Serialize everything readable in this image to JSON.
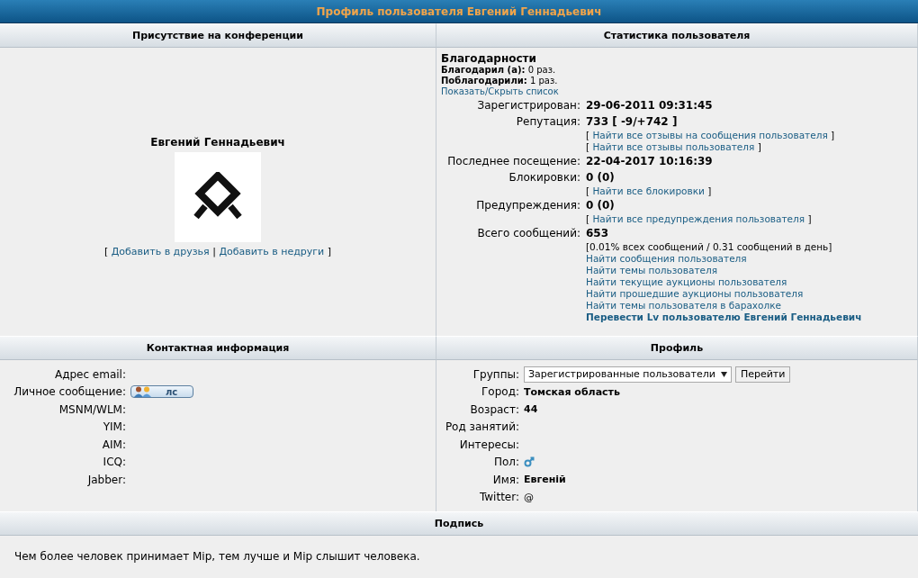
{
  "title": "Профиль пользователя Евгений Геннадьевич",
  "presence": {
    "header": "Присутствие на конференции",
    "username": "Евгений Геннадьевич",
    "links_open": "[",
    "links": [
      "Добавить в друзья",
      "Добавить в недруги"
    ],
    "links_separator": "|",
    "links_close": "]"
  },
  "stats": {
    "header": "Статистика пользователя",
    "thanks": {
      "title": "Благодарности",
      "lines": [
        {
          "label": "Благодарил (а):",
          "value": "0 раз."
        },
        {
          "label": "Поблагодарили:",
          "value": "1 раз."
        }
      ],
      "toggle": "Показать/Скрыть список"
    },
    "rows": [
      {
        "label": "Зарегистрирован:",
        "value": "29-06-2011 09:31:45",
        "extras": []
      },
      {
        "label": "Репутация:",
        "value": "733 [ -9/+742 ]",
        "extras": [
          {
            "kind": "bracket_link",
            "open": "[",
            "text": "Найти все отзывы на сообщения пользователя",
            "close": "]"
          },
          {
            "kind": "bracket_link",
            "open": "[",
            "text": "Найти все отзывы пользователя",
            "close": "]"
          }
        ]
      },
      {
        "label": "Последнее посещение:",
        "value": "22-04-2017 10:16:39",
        "extras": []
      },
      {
        "label": "Блокировки:",
        "value": "0 (0)",
        "extras": [
          {
            "kind": "bracket_link",
            "open": "[",
            "text": "Найти все блокировки",
            "close": "]"
          }
        ]
      },
      {
        "label": "Предупреждения:",
        "value": "0 (0)",
        "extras": [
          {
            "kind": "bracket_link",
            "open": "[",
            "text": "Найти все предупреждения пользователя",
            "close": "]"
          }
        ]
      },
      {
        "label": "Всего сообщений:",
        "value": "653",
        "extras": [
          {
            "kind": "note",
            "text": "[0.01% всех сообщений / 0.31 сообщений в день]"
          },
          {
            "kind": "link",
            "text": "Найти сообщения пользователя"
          },
          {
            "kind": "link",
            "text": "Найти темы пользователя"
          },
          {
            "kind": "link",
            "text": "Найти текущие аукционы пользователя"
          },
          {
            "kind": "link",
            "text": "Найти прошедшие аукционы пользователя"
          },
          {
            "kind": "link",
            "text": "Найти темы пользователя в барахолке"
          },
          {
            "kind": "strong_link",
            "text": "Перевести Lv пользователю Евгений Геннадьевич"
          }
        ]
      }
    ]
  },
  "contacts": {
    "header": "Контактная информация",
    "rows": [
      {
        "label": "Адрес email:",
        "kind": "empty"
      },
      {
        "label": "Личное сообщение:",
        "kind": "pm_button",
        "button": "лс"
      },
      {
        "label": "MSNM/WLM:",
        "kind": "empty"
      },
      {
        "label": "YIM:",
        "kind": "empty"
      },
      {
        "label": "AIM:",
        "kind": "empty"
      },
      {
        "label": "ICQ:",
        "kind": "empty"
      },
      {
        "label": "Jabber:",
        "kind": "empty"
      }
    ]
  },
  "profile": {
    "header": "Профиль",
    "rows": [
      {
        "label": "Группы:",
        "kind": "select",
        "value": "Зарегистрированные пользователи",
        "button": "Перейти"
      },
      {
        "label": "Город:",
        "kind": "text",
        "value": "Томская область"
      },
      {
        "label": "Возраст:",
        "kind": "text",
        "value": "44"
      },
      {
        "label": "Род занятий:",
        "kind": "empty"
      },
      {
        "label": "Интересы:",
        "kind": "empty"
      },
      {
        "label": "Пол:",
        "kind": "gender_icon"
      },
      {
        "label": "Имя:",
        "kind": "text",
        "value": "Евгеній"
      },
      {
        "label": "Twitter:",
        "kind": "plain",
        "value": "@"
      }
    ]
  },
  "signature": {
    "header": "Подпись",
    "text": "Чем более человек принимает Мір, тем лучше и Мір слышит человека."
  }
}
